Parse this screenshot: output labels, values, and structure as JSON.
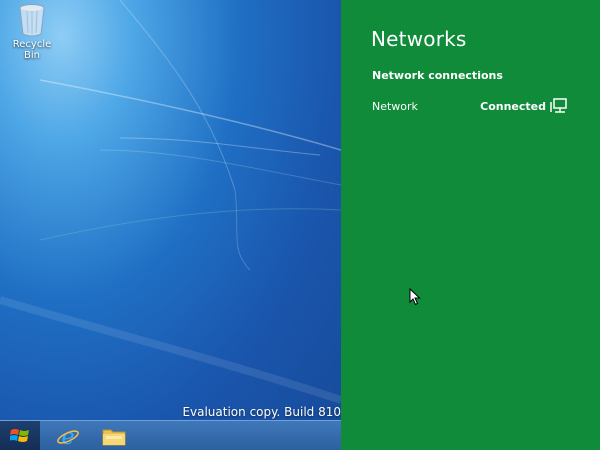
{
  "desktop": {
    "recycle_bin_label": "Recycle Bin",
    "watermark": "Evaluation copy. Build 810"
  },
  "taskbar": {
    "items": [
      {
        "name": "start",
        "icon": "windows-logo-icon"
      },
      {
        "name": "internet-explorer",
        "icon": "ie-icon"
      },
      {
        "name": "file-explorer",
        "icon": "folder-icon"
      }
    ]
  },
  "charm": {
    "title": "Networks",
    "section_label": "Network connections",
    "networks": [
      {
        "name": "Network",
        "status": "Connected",
        "icon": "wired-network-icon"
      }
    ],
    "accent_color": "#0f8b3a"
  }
}
